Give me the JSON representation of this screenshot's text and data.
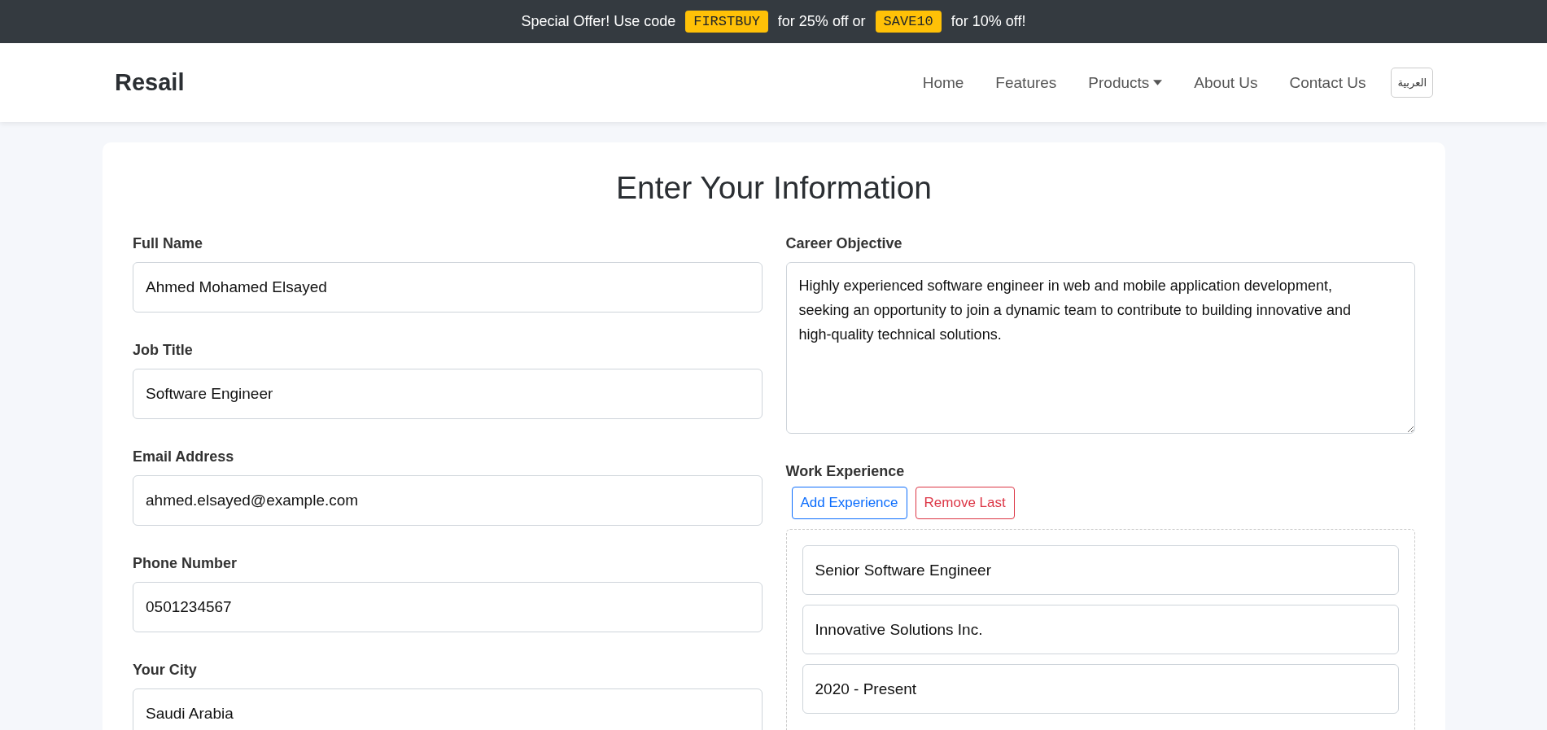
{
  "promo_bar": {
    "parts": [
      {
        "kind": "text",
        "text": "Special Offer! Use code"
      },
      {
        "kind": "code",
        "text": "FIRSTBUY"
      },
      {
        "kind": "text",
        "text": "for 25% off or"
      },
      {
        "kind": "code",
        "text": "SAVE10"
      },
      {
        "kind": "text",
        "text": "for 10% off!"
      }
    ]
  },
  "navbar": {
    "brand": "Resail",
    "links": [
      {
        "label": "Home",
        "dropdown": false
      },
      {
        "label": "Features",
        "dropdown": false
      },
      {
        "label": "Products",
        "dropdown": true
      },
      {
        "label": "About Us",
        "dropdown": false
      },
      {
        "label": "Contact Us",
        "dropdown": false
      }
    ],
    "language_button": "العربية"
  },
  "form": {
    "title": "Enter Your Information",
    "left_fields": [
      {
        "label": "Full Name",
        "value": "Ahmed Mohamed Elsayed"
      },
      {
        "label": "Job Title",
        "value": "Software Engineer"
      },
      {
        "label": "Email Address",
        "value": "ahmed.elsayed@example.com"
      },
      {
        "label": "Phone Number",
        "value": "0501234567"
      },
      {
        "label": "Your City",
        "value": "Saudi Arabia"
      }
    ],
    "career_objective": {
      "label": "Career Objective",
      "value": "Highly experienced software engineer in web and mobile application development, seeking an opportunity to join a dynamic team to contribute to building innovative and high-quality technical solutions."
    },
    "work_experience": {
      "label": "Work Experience",
      "buttons": [
        {
          "label": "Add Experience",
          "kind": "primary"
        },
        {
          "label": "Remove Last",
          "kind": "danger"
        }
      ],
      "entries": [
        {
          "value": "Senior Software Engineer"
        },
        {
          "value": "Innovative Solutions Inc."
        },
        {
          "value": "2020 - Present"
        }
      ]
    }
  }
}
